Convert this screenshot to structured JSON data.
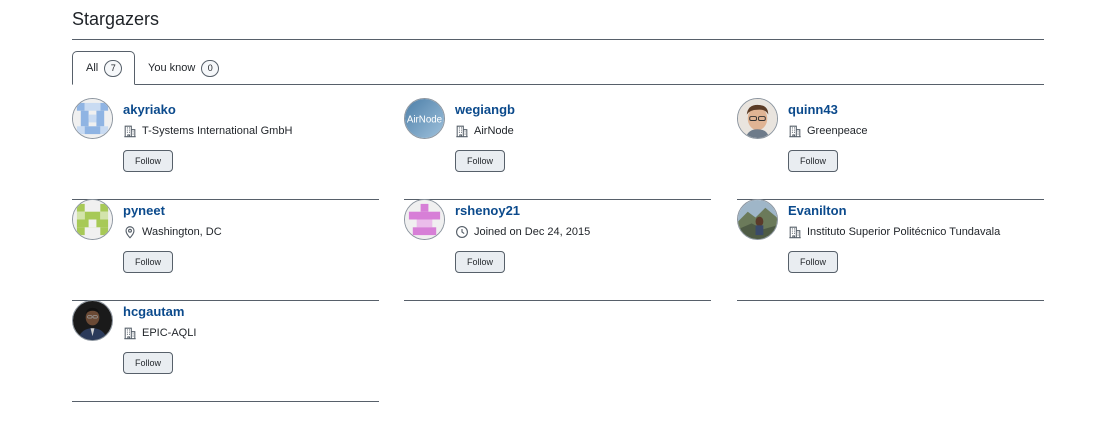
{
  "header": {
    "title": "Stargazers"
  },
  "tabs": [
    {
      "label": "All",
      "count": "7"
    },
    {
      "label": "You know",
      "count": "0"
    }
  ],
  "follow_label": "Follow",
  "users": [
    {
      "login": "akyriako",
      "meta_icon": "organization-icon",
      "meta": "T-Systems International GmbH"
    },
    {
      "login": "wegiangb",
      "meta_icon": "organization-icon",
      "meta": "AirNode"
    },
    {
      "login": "quinn43",
      "meta_icon": "organization-icon",
      "meta": "Greenpeace"
    },
    {
      "login": "pyneet",
      "meta_icon": "location-icon",
      "meta": "Washington, DC"
    },
    {
      "login": "rshenoy21",
      "meta_icon": "clock-icon",
      "meta": "Joined on Dec 24, 2015"
    },
    {
      "login": "Evanilton",
      "meta_icon": "organization-icon",
      "meta": "Instituto Superior Politécnico Tundavala"
    },
    {
      "login": "hcgautam",
      "meta_icon": "organization-icon",
      "meta": "EPIC-AQLI"
    }
  ],
  "avatar_logo_text": "AirNode",
  "colors": {
    "link": "#0b4a8c",
    "border": "#57606a",
    "button_bg": "#e9edf1",
    "identicon_blue": "#8fb4e3",
    "identicon_green": "#a7c957",
    "identicon_pink": "#d77fd7"
  }
}
